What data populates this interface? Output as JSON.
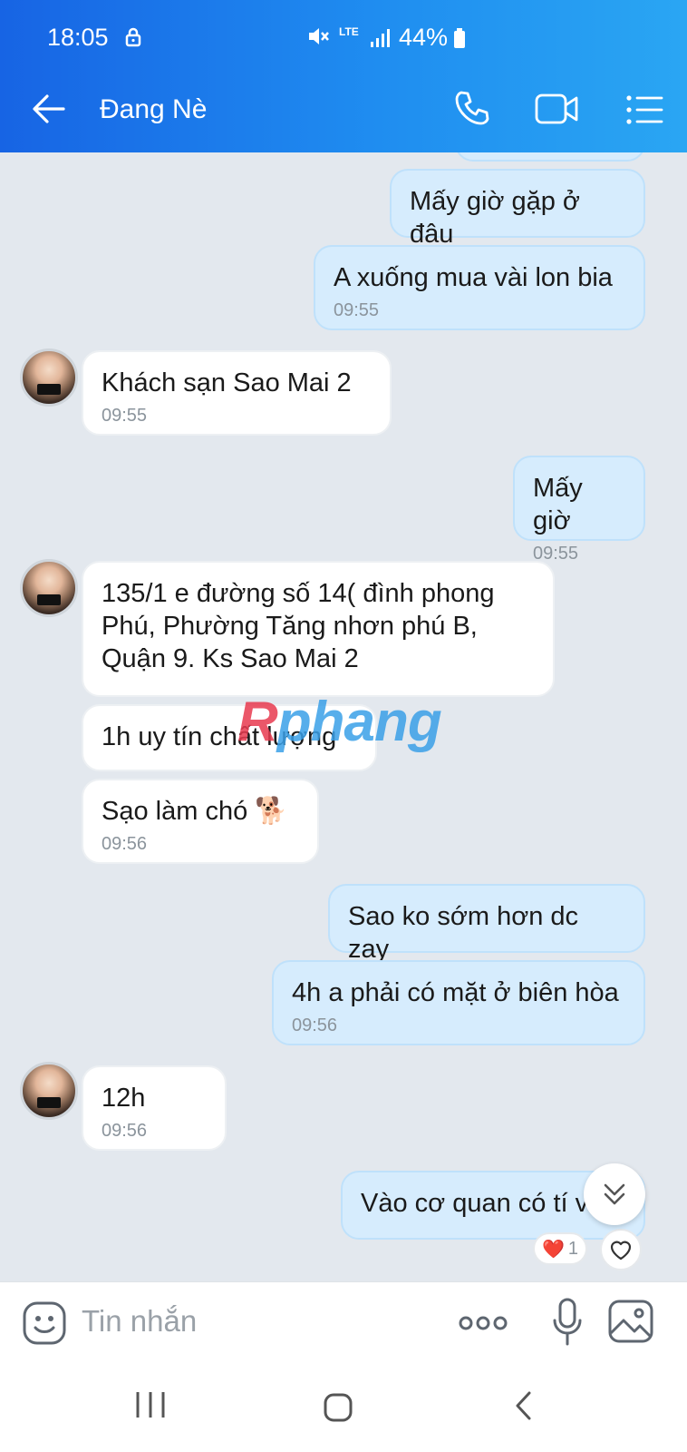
{
  "status_bar": {
    "time": "18:05",
    "network": "LTE",
    "battery": "44%"
  },
  "header": {
    "title": "Đang Nè"
  },
  "messages": [
    {
      "side": "out",
      "text": "Mấy giờ gặp ở đâu",
      "time": ""
    },
    {
      "side": "out",
      "text": "A xuống mua vài lon bia",
      "time": "09:55"
    },
    {
      "side": "in",
      "text": "Khách sạn Sao Mai 2",
      "time": "09:55"
    },
    {
      "side": "out",
      "text": "Mấy giờ",
      "time": "09:55"
    },
    {
      "side": "in",
      "text": " 135/1 e đường số 14( đình phong Phú, Phường Tăng nhơn phú B, Quận 9. Ks Sao Mai 2",
      "time": ""
    },
    {
      "side": "in",
      "text": "1h uy tín chất lượng",
      "time": ""
    },
    {
      "side": "in",
      "text": "Sạo làm chó 🐕",
      "time": "09:56"
    },
    {
      "side": "out",
      "text": "Sao ko sớm hơn dc zay",
      "time": ""
    },
    {
      "side": "out",
      "text": "4h a phải có mặt ở biên hòa",
      "time": "09:56"
    },
    {
      "side": "in",
      "text": "12h",
      "time": "09:56"
    },
    {
      "side": "out",
      "text": "Vào cơ quan có tí v",
      "time": ""
    }
  ],
  "reaction": {
    "emoji": "❤️",
    "count": "1"
  },
  "watermark": {
    "part1": "R",
    "part2": "phang"
  },
  "composer": {
    "placeholder": "Tin nhắn"
  },
  "icons": {
    "back": "arrow-left-icon",
    "call": "phone-icon",
    "video": "video-camera-icon",
    "menu": "list-icon",
    "emoji": "emoji-icon",
    "more": "more-dots-icon",
    "mic": "microphone-icon",
    "image": "image-icon",
    "scroll": "chevron-double-down-icon"
  },
  "colors": {
    "header_start": "#1764e4",
    "header_end": "#2aa6f3",
    "outgoing_bubble": "#d6ecfd",
    "incoming_bubble": "#ffffff",
    "chat_bg": "#e3e8ee"
  }
}
